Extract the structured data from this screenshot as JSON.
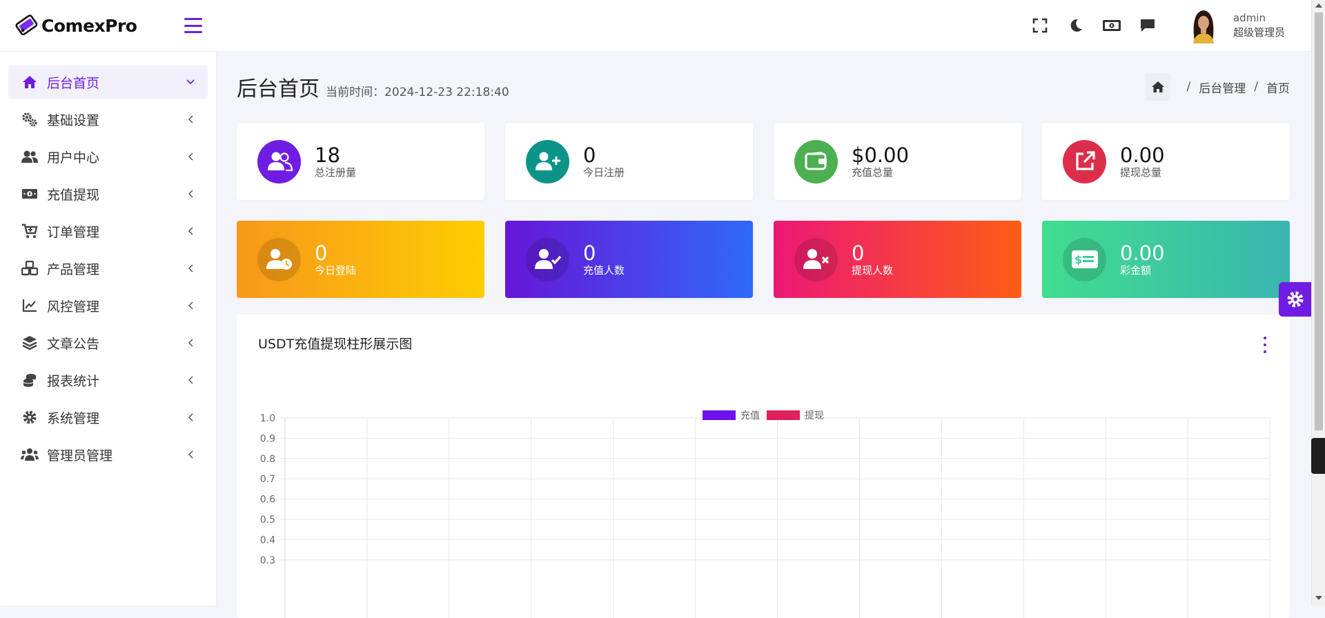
{
  "app": {
    "name": "ComexPro"
  },
  "sidebar": {
    "items": [
      {
        "label": "后台首页",
        "icon": "home-icon",
        "active": true
      },
      {
        "label": "基础设置",
        "icon": "cogs-icon"
      },
      {
        "label": "用户中心",
        "icon": "users-icon"
      },
      {
        "label": "充值提现",
        "icon": "money-icon"
      },
      {
        "label": "订单管理",
        "icon": "cart-icon"
      },
      {
        "label": "产品管理",
        "icon": "cubes-icon"
      },
      {
        "label": "风控管理",
        "icon": "line-chart-icon"
      },
      {
        "label": "文章公告",
        "icon": "layers-icon"
      },
      {
        "label": "报表统计",
        "icon": "coins-icon"
      },
      {
        "label": "系统管理",
        "icon": "gear-icon"
      },
      {
        "label": "管理员管理",
        "icon": "users-group-icon"
      }
    ]
  },
  "header": {
    "user": {
      "name": "admin",
      "role": "超级管理员"
    }
  },
  "page": {
    "title": "后台首页",
    "time_text": "当前时间：2024-12-23 22:18:40",
    "breadcrumb": [
      "后台管理",
      "首页"
    ]
  },
  "stats": [
    {
      "value": "18",
      "label": "总注册量",
      "color": "#6f1de3",
      "icon": "users-icon"
    },
    {
      "value": "0",
      "label": "今日注册",
      "color": "#0d9488",
      "icon": "user-plus-icon"
    },
    {
      "value": "$0.00",
      "label": "充值总量",
      "color": "#4caf50",
      "icon": "wallet-icon"
    },
    {
      "value": "0.00",
      "label": "提现总量",
      "color": "#dc2e4b",
      "icon": "external-link-icon"
    },
    {
      "value": "0",
      "label": "今日登陆",
      "icon": "user-clock-icon"
    },
    {
      "value": "0",
      "label": "充值人数",
      "icon": "user-check-icon"
    },
    {
      "value": "0",
      "label": "提现人数",
      "icon": "user-times-icon"
    },
    {
      "value": "0.00",
      "label": "彩金额",
      "icon": "money-check-icon"
    }
  ],
  "chart": {
    "title": "USDT充值提现柱形展示图"
  },
  "chart_data": {
    "type": "bar",
    "categories": [
      "",
      "",
      "",
      "",
      "",
      "",
      "",
      "",
      "",
      "",
      "",
      ""
    ],
    "series": [
      {
        "name": "充值",
        "color": "#6f10f0",
        "values": []
      },
      {
        "name": "提现",
        "color": "#e0205a",
        "values": []
      }
    ],
    "ylim": [
      0,
      1.0
    ],
    "yticks": [
      "1.0",
      "0.9",
      "0.8",
      "0.7",
      "0.6",
      "0.5",
      "0.4",
      "0.3"
    ],
    "grid": true,
    "legend": "top-center"
  }
}
